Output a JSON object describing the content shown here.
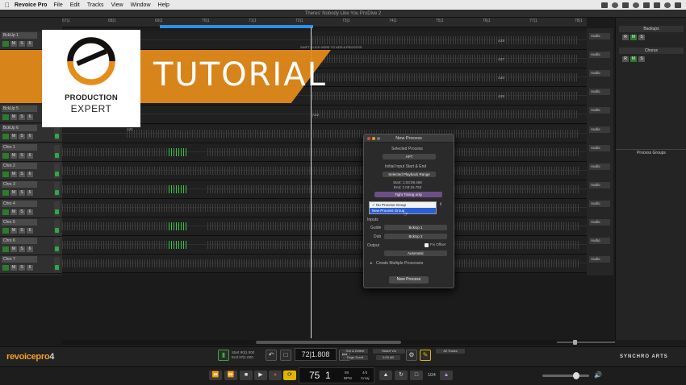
{
  "menubar": {
    "app": "Revoice Pro",
    "items": [
      "File",
      "Edit",
      "Tracks",
      "View",
      "Window",
      "Help"
    ]
  },
  "window_title": "Theres' Nobody Like You ProDive 2",
  "ruler_ticks": [
    "67|1",
    "68|1",
    "69|1",
    "70|1",
    "71|1",
    "72|1",
    "73|1",
    "74|1",
    "75|1",
    "76|1",
    "77|1",
    "78|1"
  ],
  "hint_text": "SHIFT-CLICK HERE TO ADD A PROCESS",
  "tracks": [
    {
      "name": "BckUp 1",
      "buttons": [
        "M",
        "S",
        "6"
      ]
    },
    {
      "name": "BckUp 5",
      "buttons": [
        "M",
        "S",
        "6"
      ]
    },
    {
      "name": "BckUp 6",
      "buttons": [
        "M",
        "S",
        "6"
      ]
    },
    {
      "name": "Chrs 1",
      "buttons": [
        "M",
        "S",
        "6"
      ]
    },
    {
      "name": "Chrs 2",
      "buttons": [
        "M",
        "S",
        "6"
      ]
    },
    {
      "name": "Chrs 3",
      "buttons": [
        "M",
        "S",
        "6"
      ]
    },
    {
      "name": "Chrs 4",
      "buttons": [
        "M",
        "S",
        "6"
      ]
    },
    {
      "name": "Chrs 5",
      "buttons": [
        "M",
        "S",
        "6"
      ]
    },
    {
      "name": "Chrs 6",
      "buttons": [
        "M",
        "S",
        "6"
      ]
    },
    {
      "name": "Chrs 7",
      "buttons": [
        "M",
        "S",
        "6"
      ]
    }
  ],
  "clip_labels": [
    "A29",
    "A27",
    "A20",
    "A25",
    "A22",
    "A21"
  ],
  "output_label": "Audio",
  "right_panel": {
    "group1": "Backups",
    "group2": "Chorus",
    "buttons": [
      "R",
      "M",
      "S"
    ],
    "process_groups": "Process Groups"
  },
  "dialog": {
    "title": "New Process",
    "selected_process_label": "Selected Process",
    "selected_process_value": "APT",
    "input_range_label": "Initial Input Start & End",
    "range_value": "Selected Playback Range",
    "start": "Start: 1:03:09.469",
    "end": "End: 1:03:16.753",
    "timing_value": "Tight Timing only",
    "popup_items": [
      "No Process Group",
      "New Process Group"
    ],
    "inputs_label": "Inputs",
    "guide_label": "Guide",
    "guide_value": "BckUp 1",
    "dub_label": "Dub",
    "dub_value": "BckUp 2",
    "output_label": "Output",
    "output_value": "Automatic",
    "fix_offset": "Fix Offset",
    "create_multiple": "Create Multiple Processes",
    "button": "New Process"
  },
  "bottom": {
    "brand_main": "revoicepro",
    "brand_num": "4",
    "start_label": "Start 90|1.000",
    "end_label": "End 97|1.000",
    "position": "72|1.808",
    "mini1": "Get & Delete",
    "mini2": "Match Vol",
    "mini3": "Page Scroll",
    "value": "0.00 dB",
    "mini4": "All Tracks",
    "synchro": "SYNCHRO ARTS"
  },
  "transport": {
    "bar": "75",
    "beat": "1",
    "tempo": "88",
    "tempo_label": "BPM",
    "sig": "4/4",
    "key": "Cmaj",
    "num": "1/24"
  },
  "overlay": {
    "logo_line1": "PRODUCTION",
    "logo_line2": "EXPERT",
    "banner": "TUTORIAL"
  }
}
